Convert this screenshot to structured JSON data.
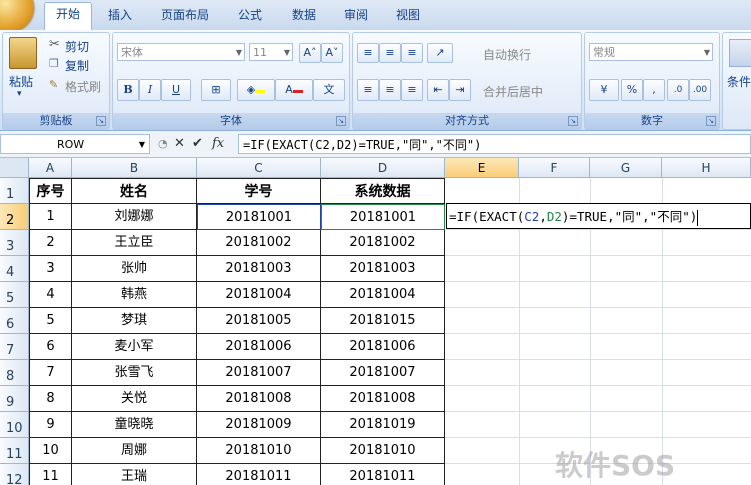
{
  "ribbon": {
    "tabs": [
      "开始",
      "插入",
      "页面布局",
      "公式",
      "数据",
      "审阅",
      "视图"
    ],
    "active_tab": "开始",
    "clipboard": {
      "paste": "粘贴",
      "cut": "剪切",
      "copy": "复制",
      "format_painter": "格式刷",
      "label": "剪贴板"
    },
    "font": {
      "name": "宋体",
      "size": "11",
      "label": "字体",
      "bold": "B",
      "italic": "I",
      "underline": "U"
    },
    "alignment": {
      "wrap": "自动换行",
      "merge": "合并后居中",
      "label": "对齐方式"
    },
    "number": {
      "format": "常规",
      "percent": "%",
      "comma": ",",
      "label": "数字"
    },
    "styles": {
      "label": "条件"
    }
  },
  "formula_bar": {
    "name_box": "ROW",
    "fx": "fx",
    "formula": "=IF(EXACT(C2,D2)=TRUE,\"同\",\"不同\")"
  },
  "columns": [
    "A",
    "B",
    "C",
    "D",
    "E",
    "F",
    "G",
    "H"
  ],
  "rows": [
    "1",
    "2",
    "3",
    "4",
    "5",
    "6",
    "7",
    "8",
    "9",
    "10",
    "11",
    "12"
  ],
  "table": {
    "headers": [
      "序号",
      "姓名",
      "学号",
      "系统数据"
    ],
    "data": [
      [
        "1",
        "刘娜娜",
        "20181001",
        "20181001"
      ],
      [
        "2",
        "王立臣",
        "20181002",
        "20181002"
      ],
      [
        "3",
        "张帅",
        "20181003",
        "20181003"
      ],
      [
        "4",
        "韩燕",
        "20181004",
        "20181004"
      ],
      [
        "5",
        "梦琪",
        "20181005",
        "20181015"
      ],
      [
        "6",
        "麦小军",
        "20181006",
        "20181006"
      ],
      [
        "7",
        "张雪飞",
        "20181007",
        "20181007"
      ],
      [
        "8",
        "关悦",
        "20181008",
        "20181008"
      ],
      [
        "9",
        "童晓晓",
        "20181009",
        "20181019"
      ],
      [
        "10",
        "周娜",
        "20181010",
        "20181010"
      ],
      [
        "11",
        "王瑞",
        "20181011",
        "20181011"
      ]
    ]
  },
  "editing_cell": {
    "prefix": "=IF(EXACT(",
    "ref_c": "C2",
    "sep": ",",
    "ref_d": "D2",
    "suffix": ")=TRUE,\"同\",\"不同\")"
  },
  "watermark": "软件SOS"
}
